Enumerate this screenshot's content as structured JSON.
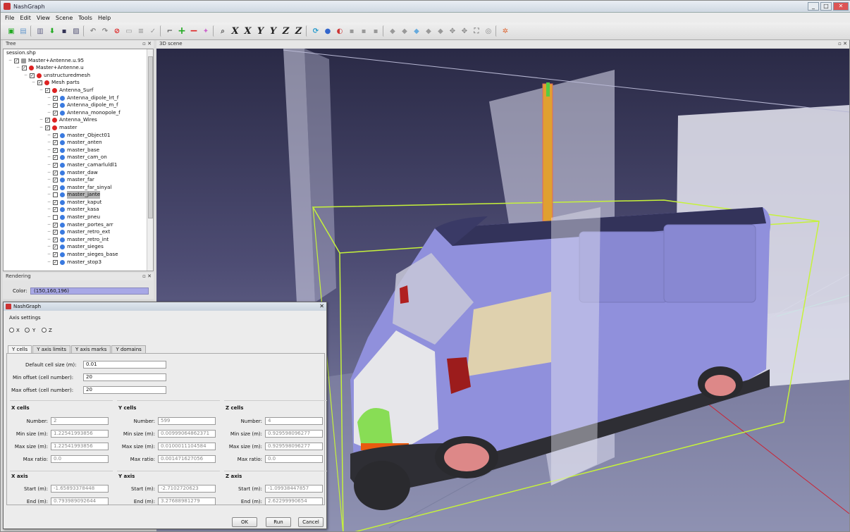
{
  "window": {
    "title": "NashGraph"
  },
  "menu": [
    "File",
    "Edit",
    "View",
    "Scene",
    "Tools",
    "Help"
  ],
  "toolbar": {
    "axis_buttons": [
      "X",
      "X",
      "Y",
      "Y",
      "Z",
      "Z"
    ]
  },
  "tree_panel": {
    "title": "Tree",
    "items": [
      {
        "label": "session.shp",
        "depth": 0,
        "checked": null,
        "icon": "none"
      },
      {
        "label": "Master+Antenne.u.95",
        "depth": 1,
        "checked": true,
        "icon": "grid"
      },
      {
        "label": "Master+Antenne.u",
        "depth": 2,
        "checked": true,
        "icon": "red"
      },
      {
        "label": "unstructuredmesh",
        "depth": 3,
        "checked": true,
        "icon": "red"
      },
      {
        "label": "Mesh parts",
        "depth": 4,
        "checked": true,
        "icon": "red"
      },
      {
        "label": "Antenna_Surf",
        "depth": 5,
        "checked": true,
        "icon": "red"
      },
      {
        "label": "Antenna_dipole_lrt_f",
        "depth": 6,
        "checked": true,
        "icon": "blue"
      },
      {
        "label": "Antenna_dipole_m_f",
        "depth": 6,
        "checked": true,
        "icon": "blue"
      },
      {
        "label": "Antenna_monopole_f",
        "depth": 6,
        "checked": true,
        "icon": "blue"
      },
      {
        "label": "Antenna_Wires",
        "depth": 5,
        "checked": true,
        "icon": "red"
      },
      {
        "label": "master",
        "depth": 5,
        "checked": true,
        "icon": "red"
      },
      {
        "label": "master_Object01",
        "depth": 6,
        "checked": true,
        "icon": "blue"
      },
      {
        "label": "master_anten",
        "depth": 6,
        "checked": true,
        "icon": "blue"
      },
      {
        "label": "master_base",
        "depth": 6,
        "checked": true,
        "icon": "blue"
      },
      {
        "label": "master_cam_on",
        "depth": 6,
        "checked": true,
        "icon": "blue"
      },
      {
        "label": "master_camarluldl1",
        "depth": 6,
        "checked": true,
        "icon": "blue"
      },
      {
        "label": "master_daw",
        "depth": 6,
        "checked": true,
        "icon": "blue"
      },
      {
        "label": "master_far",
        "depth": 6,
        "checked": true,
        "icon": "blue"
      },
      {
        "label": "master_far_sinyal",
        "depth": 6,
        "checked": true,
        "icon": "blue"
      },
      {
        "label": "master_jante",
        "depth": 6,
        "checked": false,
        "icon": "blue",
        "selected": true
      },
      {
        "label": "master_kaput",
        "depth": 6,
        "checked": true,
        "icon": "blue"
      },
      {
        "label": "master_kasa",
        "depth": 6,
        "checked": true,
        "icon": "blue"
      },
      {
        "label": "master_pneu",
        "depth": 6,
        "checked": false,
        "icon": "blue"
      },
      {
        "label": "master_portes_arr",
        "depth": 6,
        "checked": true,
        "icon": "blue"
      },
      {
        "label": "master_retro_ext",
        "depth": 6,
        "checked": true,
        "icon": "blue"
      },
      {
        "label": "master_retro_int",
        "depth": 6,
        "checked": true,
        "icon": "blue"
      },
      {
        "label": "master_sieges",
        "depth": 6,
        "checked": true,
        "icon": "blue"
      },
      {
        "label": "master_sieges_base",
        "depth": 6,
        "checked": true,
        "icon": "blue"
      },
      {
        "label": "master_stop3",
        "depth": 6,
        "checked": true,
        "icon": "blue"
      }
    ]
  },
  "rendering_panel": {
    "title": "Rendering",
    "color_label": "Color:",
    "color_value": "(150,160,196)"
  },
  "scene_panel": {
    "title": "3D scene"
  },
  "dialog": {
    "title": "NashGraph",
    "axis_settings_label": "Axis settings",
    "radio_labels": [
      "X",
      "Y",
      "Z"
    ],
    "selected_axis": "Y",
    "tabs": [
      {
        "label": "Y cells",
        "active": true
      },
      {
        "label": "Y axis limits",
        "active": false
      },
      {
        "label": "Y axis marks",
        "active": false
      },
      {
        "label": "Y domains",
        "active": false
      }
    ],
    "settings": {
      "default_cell_label": "Default cell size (m):",
      "default_cell_value": "0.01",
      "min_offset_label": "Min offset (cell number):",
      "min_offset_value": "20",
      "max_offset_label": "Max offset (cell number):",
      "max_offset_value": "20"
    },
    "cells": [
      {
        "title": "X cells",
        "number": "2",
        "min_size": "1.22541993856",
        "max_size": "1.22541993856",
        "max_ratio": "0.0"
      },
      {
        "title": "Y cells",
        "number": "599",
        "min_size": "0.00999064862371",
        "max_size": "0.0100011104584",
        "max_ratio": "0.00147162705​6"
      },
      {
        "title": "Z cells",
        "number": "4",
        "min_size": "0.929598096277",
        "max_size": "0.929598096277",
        "max_ratio": "0.0"
      }
    ],
    "cell_field_labels": {
      "number": "Number:",
      "min_size": "Min size (m):",
      "max_size": "Max size (m):",
      "max_ratio": "Max ratio:"
    },
    "axes": [
      {
        "title": "X axis",
        "start": "-1.65893378448",
        "end": "0.793989092644"
      },
      {
        "title": "Y axis",
        "start": "-2.7102720623",
        "end": "3.27688981279"
      },
      {
        "title": "Z axis",
        "start": "-1.09938447857",
        "end": "2.62299990654"
      }
    ],
    "axis_field_labels": {
      "start": "Start (m):",
      "end": "End (m):"
    },
    "buttons": {
      "ok": "OK",
      "run": "Run",
      "cancel": "Cancel"
    }
  }
}
